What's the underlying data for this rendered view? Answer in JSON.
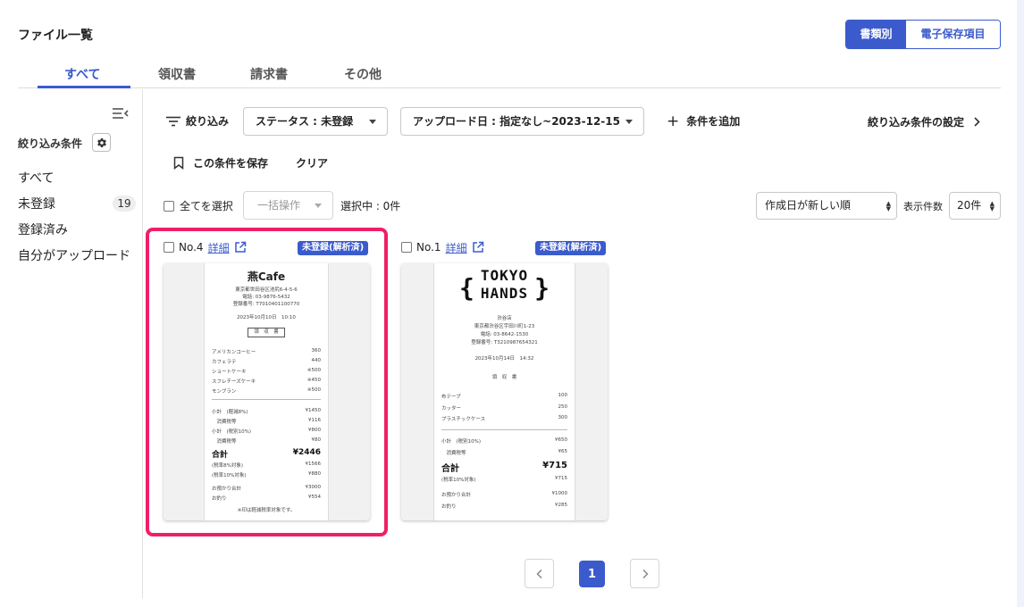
{
  "header": {
    "title": "ファイル一覧",
    "view_toggle": {
      "active": "書類別",
      "inactive": "電子保存項目"
    }
  },
  "tabs": [
    {
      "label": "すべて"
    },
    {
      "label": "領収書"
    },
    {
      "label": "請求書"
    },
    {
      "label": "その他"
    }
  ],
  "sidebar": {
    "filter_heading": "絞り込み条件",
    "items": [
      {
        "label": "すべて"
      },
      {
        "label": "未登録",
        "count": "19"
      },
      {
        "label": "登録済み"
      },
      {
        "label": "自分がアップロード"
      }
    ]
  },
  "filters": {
    "filter_label": "絞り込み",
    "status_select": "ステータス : 未登録",
    "date_select": "アップロード日 : 指定なし~2023-12-15",
    "add_condition": "条件を追加",
    "condition_settings": "絞り込み条件の設定",
    "save_condition": "この条件を保存",
    "clear": "クリア"
  },
  "toolbar": {
    "select_all": "全てを選択",
    "bulk_action": "一括操作",
    "selected": "選択中 : 0件",
    "sort": "作成日が新しい順",
    "per_page_label": "表示件数",
    "per_page": "20件"
  },
  "cards": [
    {
      "number": "No.4",
      "detail": "詳細",
      "status": "未登録(解析済)",
      "receipt": {
        "store": "燕Cafe",
        "address": "東京都世田谷区池尻6-4-5-6",
        "phone": "電話: 03-9876-5432",
        "reg": "登録番号: T7010401100770",
        "datetime": "2023年10月10日　10:10",
        "doc_type": "領　収　書",
        "items": [
          {
            "name": "アメリカンコーヒー",
            "price": "360"
          },
          {
            "name": "カフェラテ",
            "price": "440"
          },
          {
            "name": "ショートケーキ",
            "price": "※500"
          },
          {
            "name": "スフレチーズケーキ",
            "price": "※450"
          },
          {
            "name": "モンブラン",
            "price": "※500"
          }
        ],
        "subtotals": [
          {
            "name": "小計　(軽減8%)",
            "price": "¥1450"
          },
          {
            "name": "　消費税等",
            "price": "¥116"
          },
          {
            "name": "小計　(税別10%)",
            "price": "¥800"
          },
          {
            "name": "　消費税等",
            "price": "¥80"
          }
        ],
        "total_label": "合計",
        "total": "¥2446",
        "tax_lines": [
          {
            "name": "(税率8%対象)",
            "price": "¥1566"
          },
          {
            "name": "(税率10%対象)",
            "price": "¥880"
          }
        ],
        "payment": [
          {
            "name": "お預かり合計",
            "price": "¥3000"
          },
          {
            "name": "お釣り",
            "price": "¥554"
          }
        ],
        "note": "※印は軽減税率対象です。"
      }
    },
    {
      "number": "No.1",
      "detail": "詳細",
      "status": "未登録(解析済)",
      "receipt": {
        "logo_line1": "TOKYO",
        "logo_line2": "HANDS",
        "store": "渋谷店",
        "address": "東京都渋谷区宇田川町1-23",
        "phone": "電話: 03-8642-1530",
        "reg": "登録番号: T3210987654321",
        "datetime": "2023年10月14日　14:32",
        "doc_type": "領　収　書",
        "items": [
          {
            "name": "布テープ",
            "price": "100"
          },
          {
            "name": "カッター",
            "price": "250"
          },
          {
            "name": "プラスチックケース",
            "price": "300"
          }
        ],
        "subtotals": [
          {
            "name": "小計　(税別10%)",
            "price": "¥650"
          },
          {
            "name": "　消費税等",
            "price": "¥65"
          }
        ],
        "total_label": "合計",
        "total": "¥715",
        "tax_lines": [
          {
            "name": "(税率10%対象)",
            "price": "¥715"
          }
        ],
        "payment": [
          {
            "name": "お預かり合計",
            "price": "¥1000"
          },
          {
            "name": "お釣り",
            "price": "¥285"
          }
        ]
      }
    }
  ],
  "pagination": {
    "current": "1"
  },
  "colors": {
    "accent": "#3b5bcc",
    "highlight": "#ee1f68"
  }
}
